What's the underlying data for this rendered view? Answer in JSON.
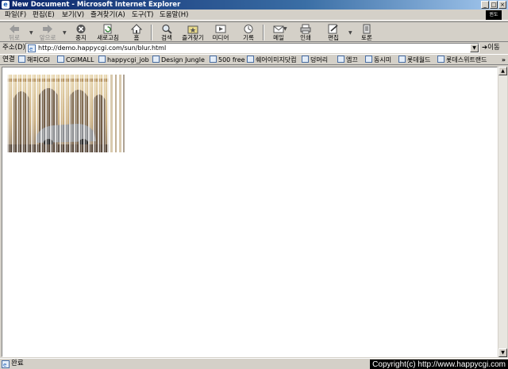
{
  "window": {
    "title": "New Document - Microsoft Internet Explorer",
    "icon": "ie-icon",
    "controls": [
      "minimize",
      "maximize",
      "close"
    ]
  },
  "menu": {
    "items": [
      "파일(F)",
      "편집(E)",
      "보기(V)",
      "즐겨찾기(A)",
      "도구(T)",
      "도움말(H)"
    ],
    "brand_tile": "윈도"
  },
  "toolbar": {
    "buttons": [
      {
        "label": "뒤로",
        "icon": "back-arrow-icon",
        "enabled": false
      },
      {
        "label": "앞으로",
        "icon": "forward-arrow-icon",
        "enabled": false
      },
      {
        "label": "중지",
        "icon": "stop-icon",
        "enabled": true
      },
      {
        "label": "새로고침",
        "icon": "refresh-icon",
        "enabled": true
      },
      {
        "label": "홈",
        "icon": "home-icon",
        "enabled": true
      },
      {
        "label": "검색",
        "icon": "search-icon",
        "enabled": true
      },
      {
        "label": "즐겨찾기",
        "icon": "favorites-icon",
        "enabled": true
      },
      {
        "label": "미디어",
        "icon": "media-icon",
        "enabled": true
      },
      {
        "label": "기록",
        "icon": "history-icon",
        "enabled": true
      },
      {
        "label": "메일",
        "icon": "mail-icon",
        "enabled": true
      },
      {
        "label": "인쇄",
        "icon": "print-icon",
        "enabled": true
      },
      {
        "label": "편집",
        "icon": "edit-icon",
        "enabled": true
      },
      {
        "label": "토론",
        "icon": "discuss-icon",
        "enabled": true
      }
    ]
  },
  "address": {
    "label": "주소(D)",
    "url": "http://demo.happycgi.com/sun/blur.html",
    "go_label": "이동"
  },
  "links": {
    "label": "연결",
    "items": [
      "해피CGI",
      "CGIMALL",
      "happycgi_job",
      "Design Jungle",
      "500 free",
      "쉐어이미지닷컴",
      "덩머리",
      "엠끄",
      "동시미",
      "롯데월드",
      "롯데스위트랜드"
    ]
  },
  "status": {
    "text": "완료",
    "copyright": "Copyright(c) http://www.happycgi.com"
  },
  "colors": {
    "titlebar_start": "#0a246a",
    "titlebar_end": "#a6caf0",
    "chrome": "#d4d0c8",
    "content_bg": "#ffffff"
  }
}
